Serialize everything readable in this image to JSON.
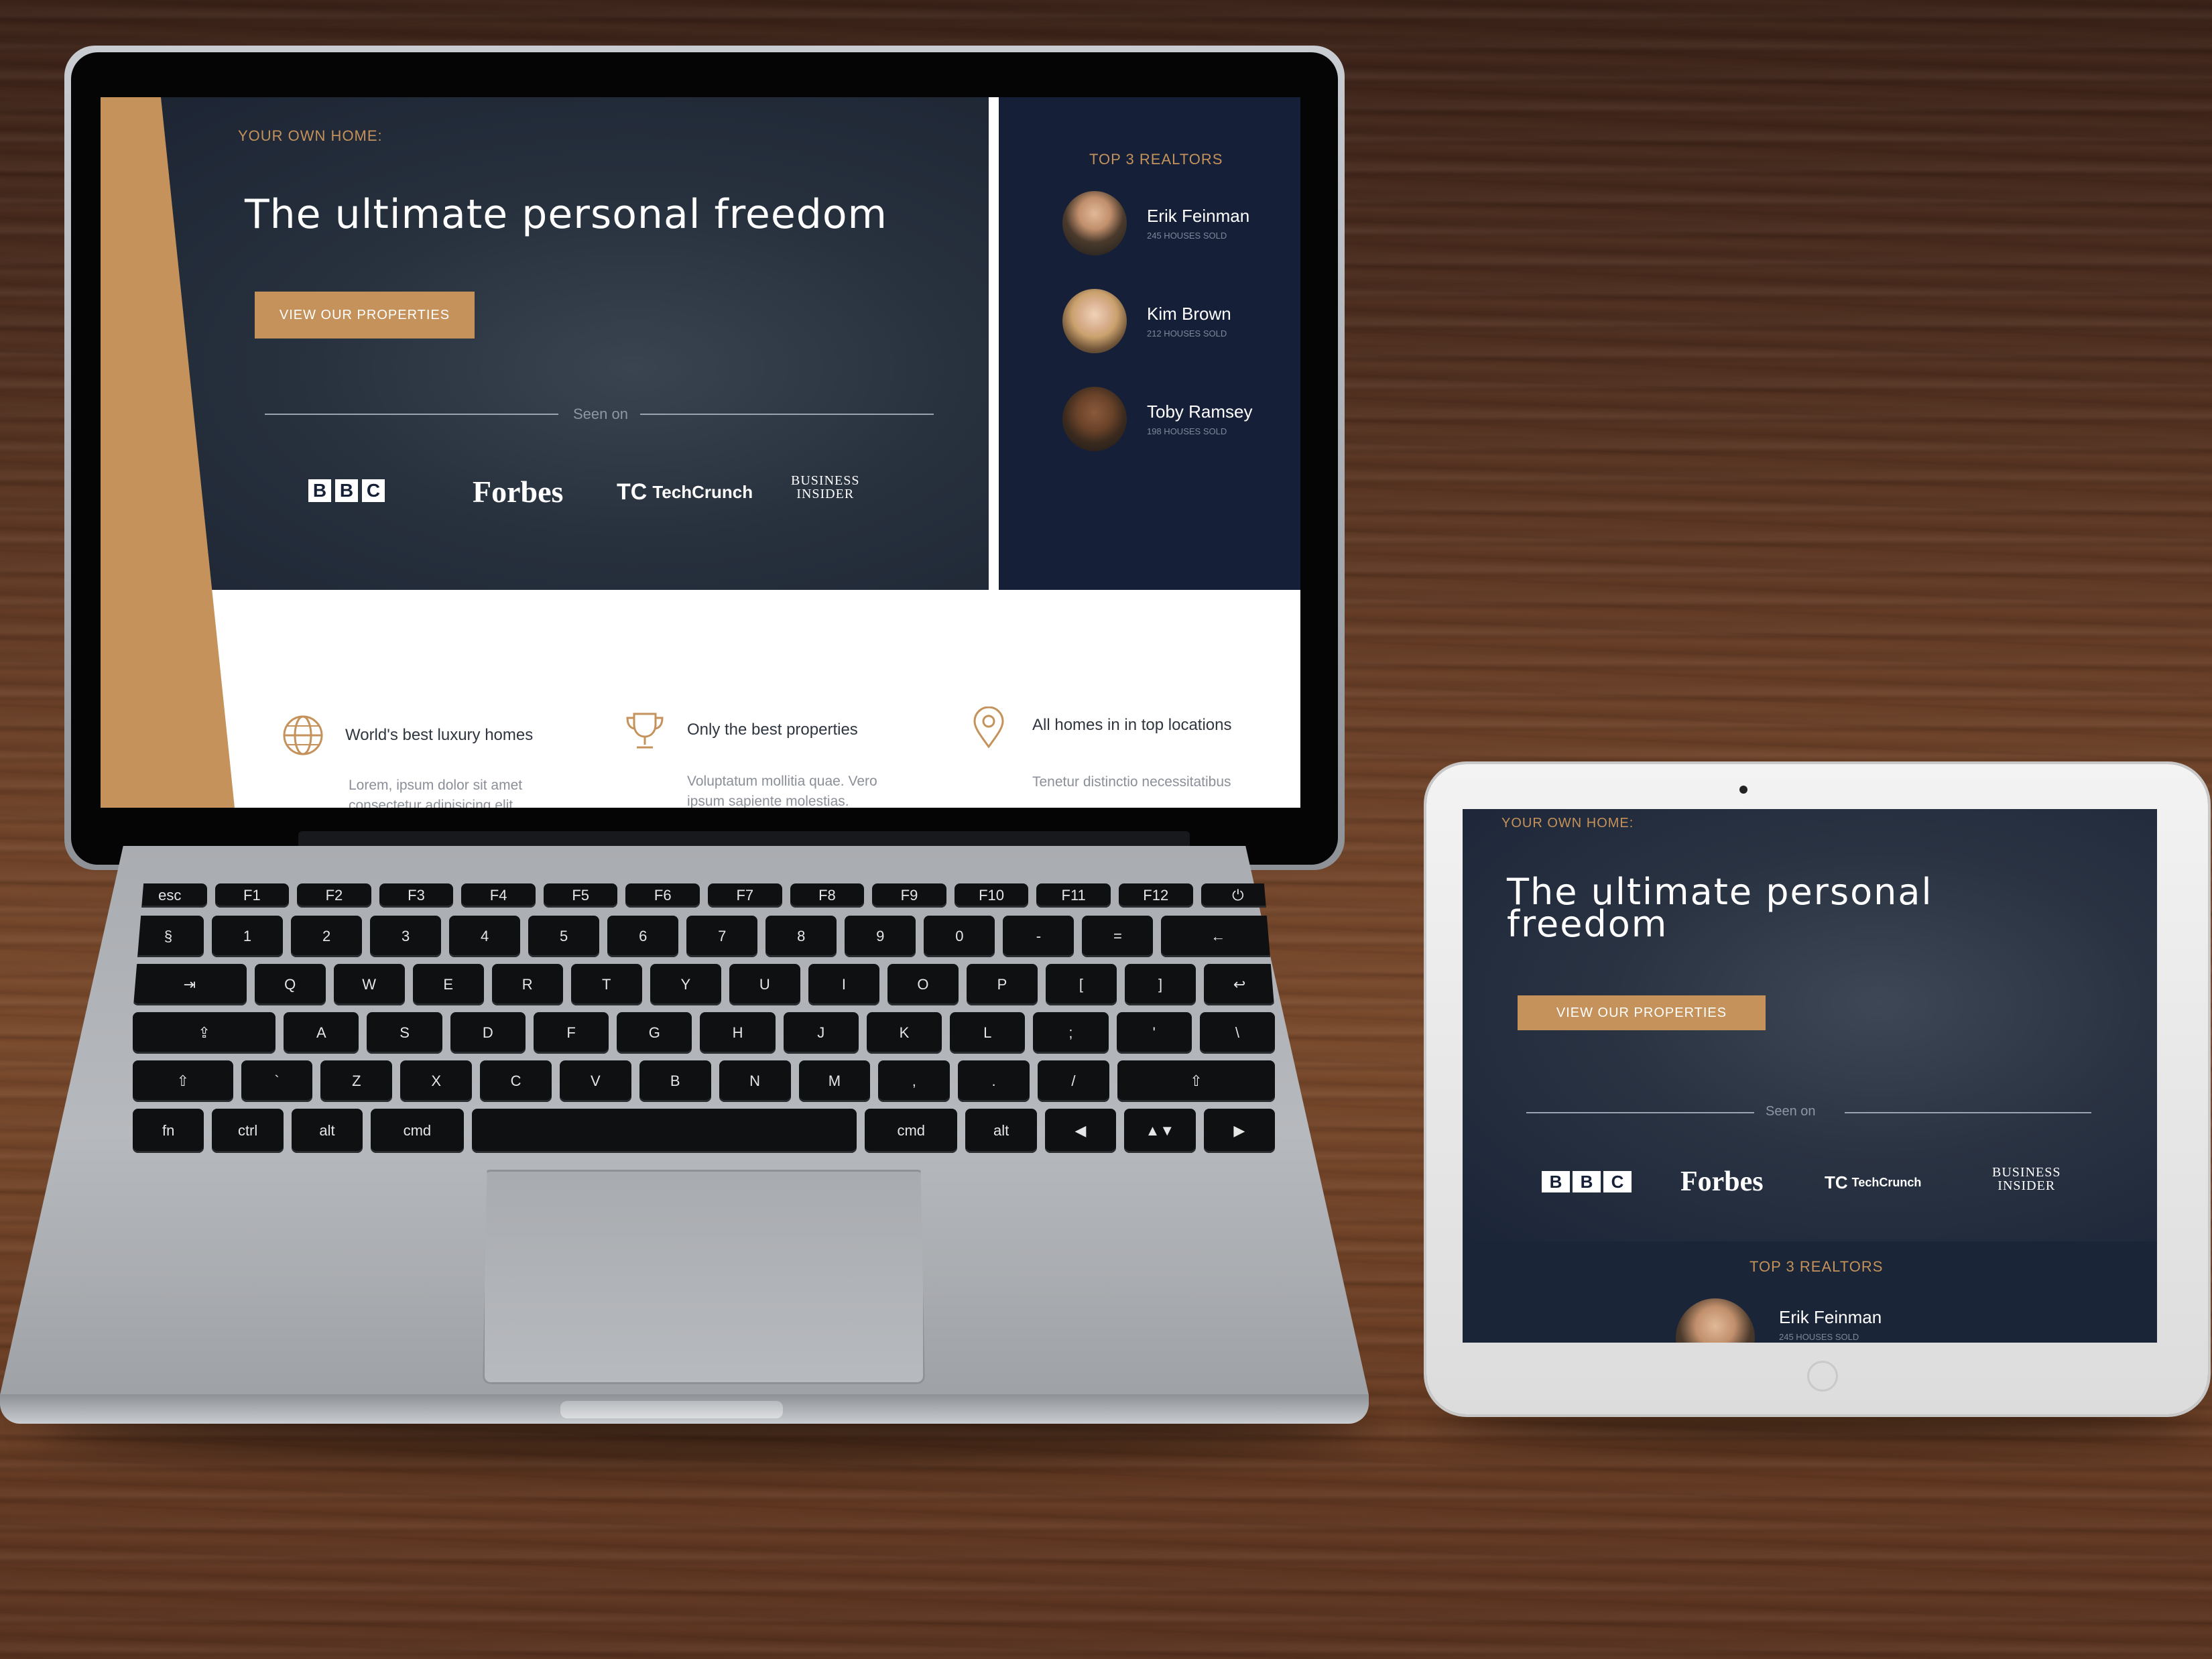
{
  "site": {
    "eyebrow": "YOUR OWN HOME:",
    "hero_title": "The ultimate personal freedom",
    "hero_title_tablet_line1": "The ultimate personal",
    "hero_title_tablet_line2": "freedom",
    "cta_label": "VIEW OUR PROPERTIES",
    "seen_on_label": "Seen on",
    "press_logos": {
      "bbc": [
        "B",
        "B",
        "C"
      ],
      "forbes": "Forbes",
      "techcrunch_mark": "TC",
      "techcrunch": "TechCrunch",
      "business_line1": "BUSINESS",
      "insider_line2": "INSIDER"
    },
    "realtors_title": "TOP 3 REALTORS",
    "realtors": [
      {
        "name": "Erik Feinman",
        "sold": "245 HOUSES SOLD"
      },
      {
        "name": "Kim Brown",
        "sold": "212 HOUSES SOLD"
      },
      {
        "name": "Toby Ramsey",
        "sold": "198 HOUSES SOLD"
      }
    ],
    "features": [
      {
        "icon": "globe-icon",
        "title": "World's best luxury homes",
        "body": "Lorem, ipsum dolor sit amet consectetur adipisicing elit."
      },
      {
        "icon": "trophy-icon",
        "title": "Only the best properties",
        "body": "Voluptatum mollitia quae. Vero ipsum sapiente molestias."
      },
      {
        "icon": "location-pin-icon",
        "title": "All homes in in top locations",
        "body": "Tenetur distinctio necessitatibus"
      }
    ]
  },
  "keyboard": {
    "row_fn": [
      "esc",
      "F1",
      "F2",
      "F3",
      "F4",
      "F5",
      "F6",
      "F7",
      "F8",
      "F9",
      "F10",
      "F11",
      "F12",
      "⏻"
    ],
    "row_num": [
      "§",
      "1",
      "2",
      "3",
      "4",
      "5",
      "6",
      "7",
      "8",
      "9",
      "0",
      "-",
      "=",
      "←"
    ],
    "row_q": [
      "⇥",
      "Q",
      "W",
      "E",
      "R",
      "T",
      "Y",
      "U",
      "I",
      "O",
      "P",
      "[",
      "]",
      "↩"
    ],
    "row_a": [
      "⇪",
      "A",
      "S",
      "D",
      "F",
      "G",
      "H",
      "J",
      "K",
      "L",
      ";",
      "'",
      "\\"
    ],
    "row_z": [
      "⇧",
      "`",
      "Z",
      "X",
      "C",
      "V",
      "B",
      "N",
      "M",
      ",",
      ".",
      "/",
      "⇧"
    ],
    "row_bottom": [
      "fn",
      "ctrl",
      "alt",
      "cmd",
      "",
      "cmd",
      "alt",
      "◀",
      "▲▼",
      "▶"
    ]
  },
  "colors": {
    "navy": "#1c2433",
    "gold": "#c4925a",
    "white": "#ffffff"
  }
}
